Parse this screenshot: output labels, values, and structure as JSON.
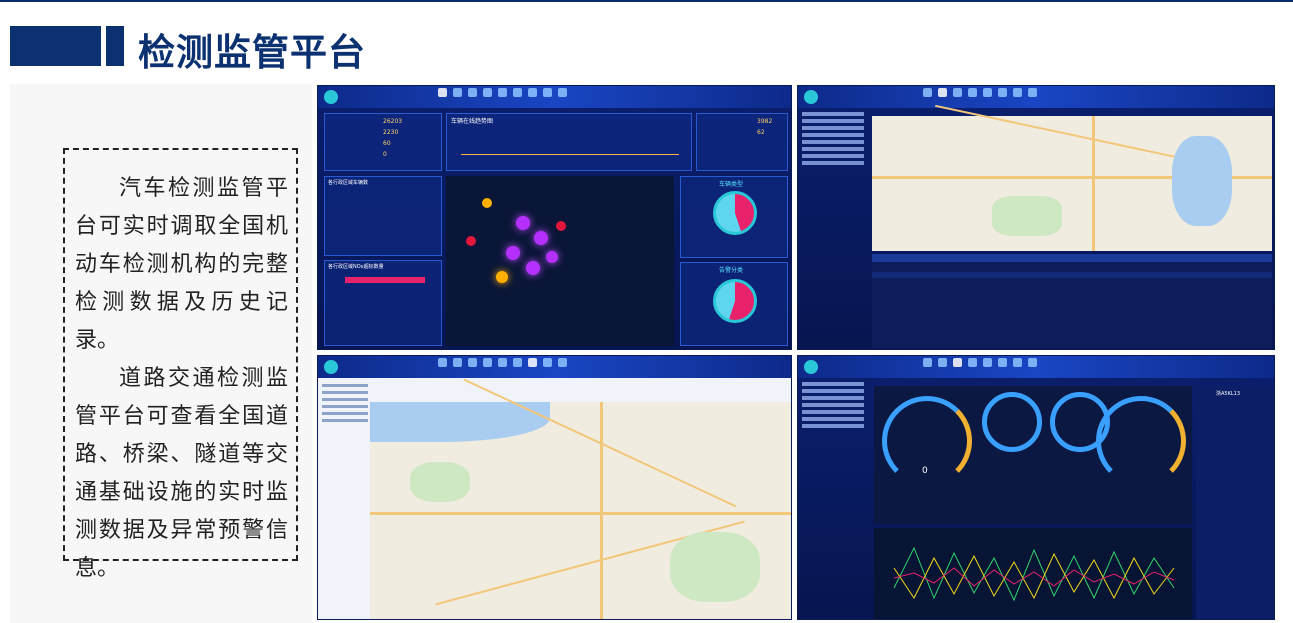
{
  "page": {
    "title": "检测监管平台",
    "paragraph1": "汽车检测监管平台可实时调取全国机动车检测机构的完整检测数据及历史记录。",
    "paragraph2": "道路交通检测监管平台可查看全国道路、桥梁、隧道等交通基础设施的实时监测数据及异常预警信息。"
  },
  "colors": {
    "title": "#0b3170",
    "accent_bar": "#0b3170",
    "dashboard_bg": "#0a1f6e"
  },
  "screenshots": [
    {
      "name": "vehicle-dashboard",
      "label_online": "车辆在线趋势图",
      "label_type": "车辆类型",
      "label_alarm": "告警分类",
      "label_province": "各行政区域车辆数",
      "label_nox": "各行政区域NOx超标数量",
      "stat1": "26203",
      "stat2": "2230",
      "stat3": "60",
      "stat4": "0",
      "stat5": "3982",
      "stat6": "62"
    },
    {
      "name": "monitoring-map-view"
    },
    {
      "name": "road-traffic-map"
    },
    {
      "name": "vehicle-realtime-gauges",
      "speed": "0",
      "plate": "浙A5KL13"
    }
  ]
}
